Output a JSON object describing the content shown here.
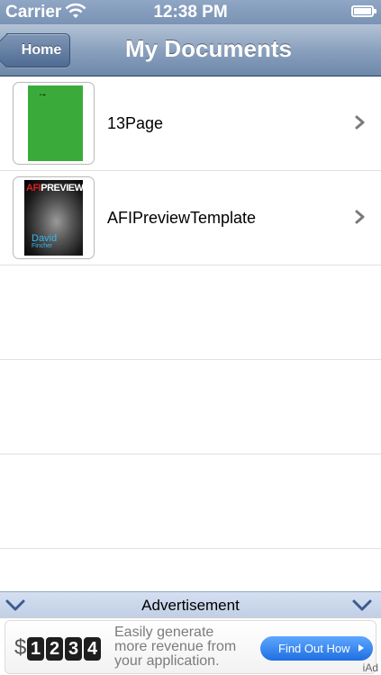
{
  "status_bar": {
    "carrier": "Carrier",
    "time": "12:38 PM"
  },
  "nav": {
    "back_label": "Home",
    "title": "My Documents"
  },
  "documents": [
    {
      "name": "13Page",
      "thumbnail": "green-page"
    },
    {
      "name": "AFIPreviewTemplate",
      "thumbnail": "magazine-cover"
    }
  ],
  "thumbnail_text": {
    "magazine_title_red": "AFI",
    "magazine_title_white": "PREVIEW",
    "magazine_name": "David",
    "magazine_sub": "Fincher"
  },
  "ad_bar": {
    "label": "Advertisement"
  },
  "ad_banner": {
    "currency": "$",
    "digits": [
      "1",
      "2",
      "3",
      "4"
    ],
    "text_line1": "Easily generate",
    "text_line2": "more revenue from",
    "text_line3": "your application.",
    "button_label": "Find Out How",
    "brand": "iAd"
  },
  "colors": {
    "nav_gradient_top": "#b4c3d6",
    "nav_gradient_bottom": "#6e88aa",
    "thumbnail_green": "#3aab3a",
    "ad_button": "#1f6fe0"
  }
}
